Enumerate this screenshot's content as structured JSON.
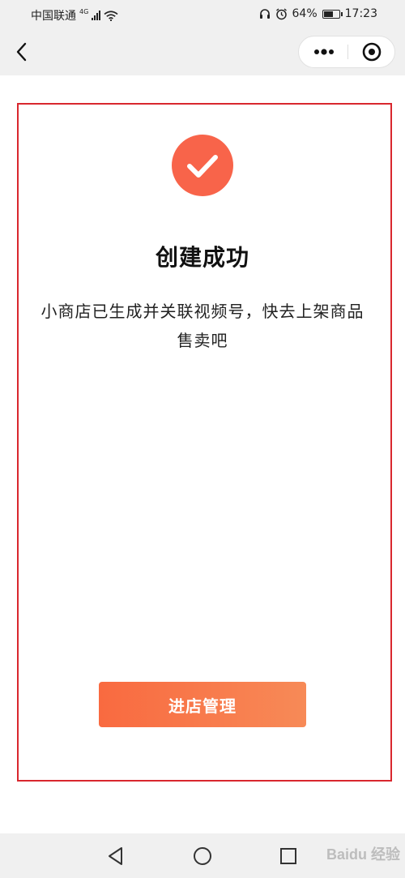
{
  "status_bar": {
    "carrier": "中国联通",
    "network": "4G",
    "battery": "64%",
    "battery_level": 0.64,
    "time": "17:23"
  },
  "nav": {
    "back_icon": "chevron-left-icon",
    "more_icon": "more-dots-icon",
    "close_icon": "target-circle-icon"
  },
  "main": {
    "icon": "check-circle-icon",
    "title": "创建成功",
    "description": "小商店已生成并关联视频号，快去上架商品售卖吧",
    "button_label": "进店管理"
  },
  "colors": {
    "accent": "#f8644a",
    "button_start": "#f96a40",
    "button_end": "#f78a57",
    "highlight_frame": "#d9272e"
  },
  "watermark": "Baidu 经验"
}
